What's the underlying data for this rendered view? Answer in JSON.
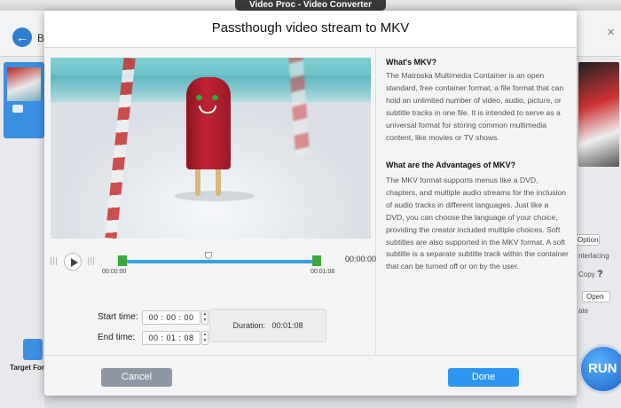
{
  "app": {
    "window_title": "Video Proc - Video Converter",
    "back_label": "B"
  },
  "sidebar_right": {
    "options_label": "Options",
    "interlacing_label": "nterlacing",
    "copy_label": "Copy",
    "help_label": "?",
    "open_label": "Open",
    "ate_text": "ate"
  },
  "target_format": {
    "label": "Target For"
  },
  "run_button": {
    "label": "RUN"
  },
  "dialog": {
    "title": "Passthough video stream to MKV",
    "timeline": {
      "start_tick": "00:00:00",
      "end_tick": "00:01:08",
      "total": "00:00:00"
    },
    "start_time": {
      "label": "Start time:",
      "value": "00 : 00 : 00"
    },
    "end_time": {
      "label": "End time:",
      "value": "00 : 01 : 08"
    },
    "duration": {
      "label": "Duration:",
      "value": "00:01:08"
    },
    "info": {
      "heading1": "What's MKV?",
      "body1": "The Matroska Multimedia Container is an open standard, free container format, a file format that can hold an unlimited number of video, audio, picture, or subtitle tracks in one file. It is intended to serve as a universal format for storing common multimedia content, like movies or TV shows.",
      "heading2": "What are the Advantages of MKV?",
      "body2": "The MKV format supports menus like a DVD, chapters, and multiple audio streams for the inclusion of audio tracks in different languages. Just like a DVD, you can choose the language of your choice, providing the creator included multiple choices. Soft subtitles are also supported in the MKV format. A soft subtitle is a separate subtitle track within the container that can be turned off or on by the user."
    },
    "cancel_label": "Cancel",
    "done_label": "Done"
  }
}
